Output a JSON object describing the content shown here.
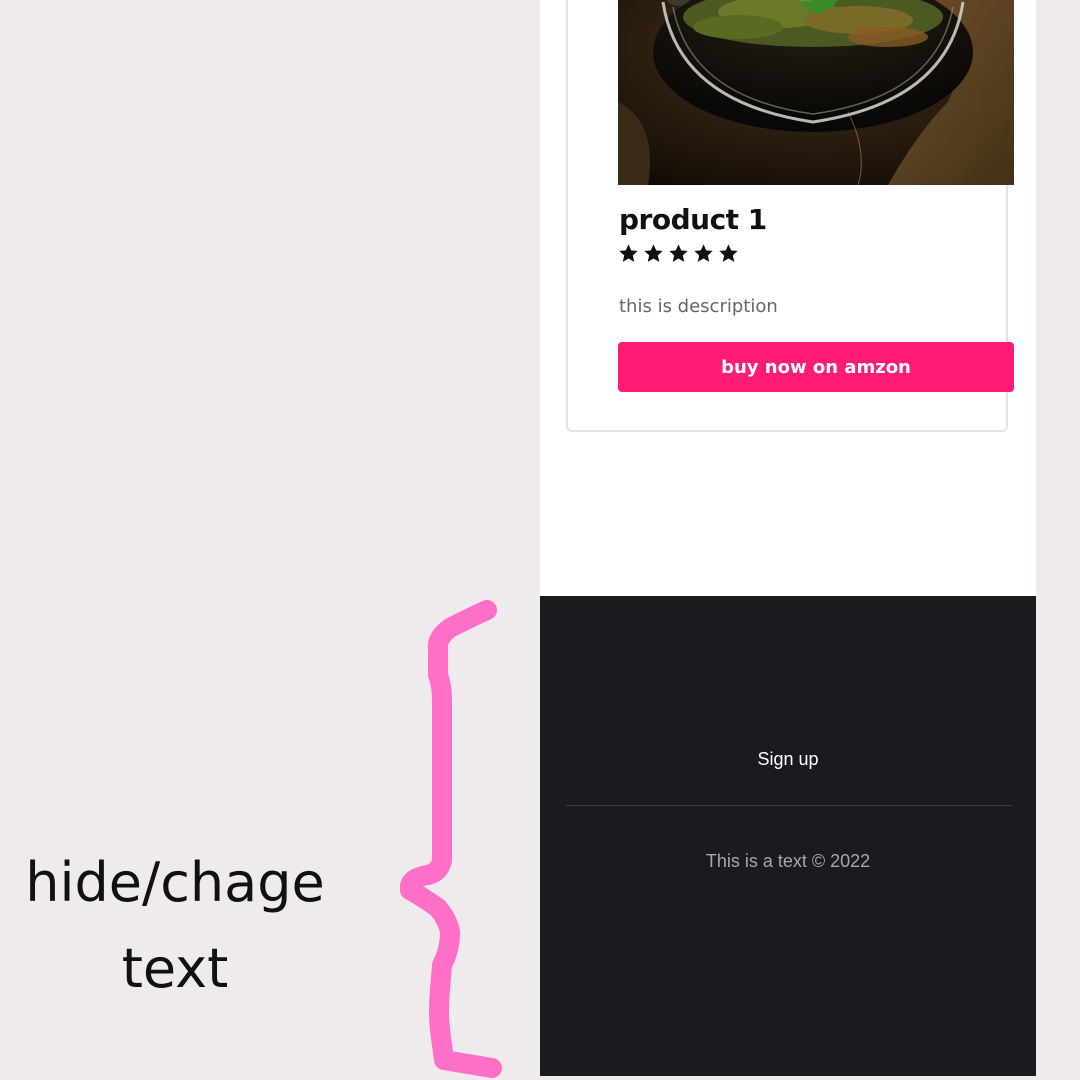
{
  "annotation": {
    "text_line1": "hide/chage",
    "text_line2": "text",
    "brace_color": "#ff6ec7"
  },
  "product": {
    "title": "product 1",
    "rating": 5,
    "rating_max": 5,
    "description": "this is description",
    "button_label": "buy now on amzon",
    "accent_color": "#ff1b76",
    "image": "terrarium-photo"
  },
  "footer": {
    "signup_label": "Sign up",
    "copyright": "This is a text © 2022",
    "background": "#1a1b1f"
  }
}
